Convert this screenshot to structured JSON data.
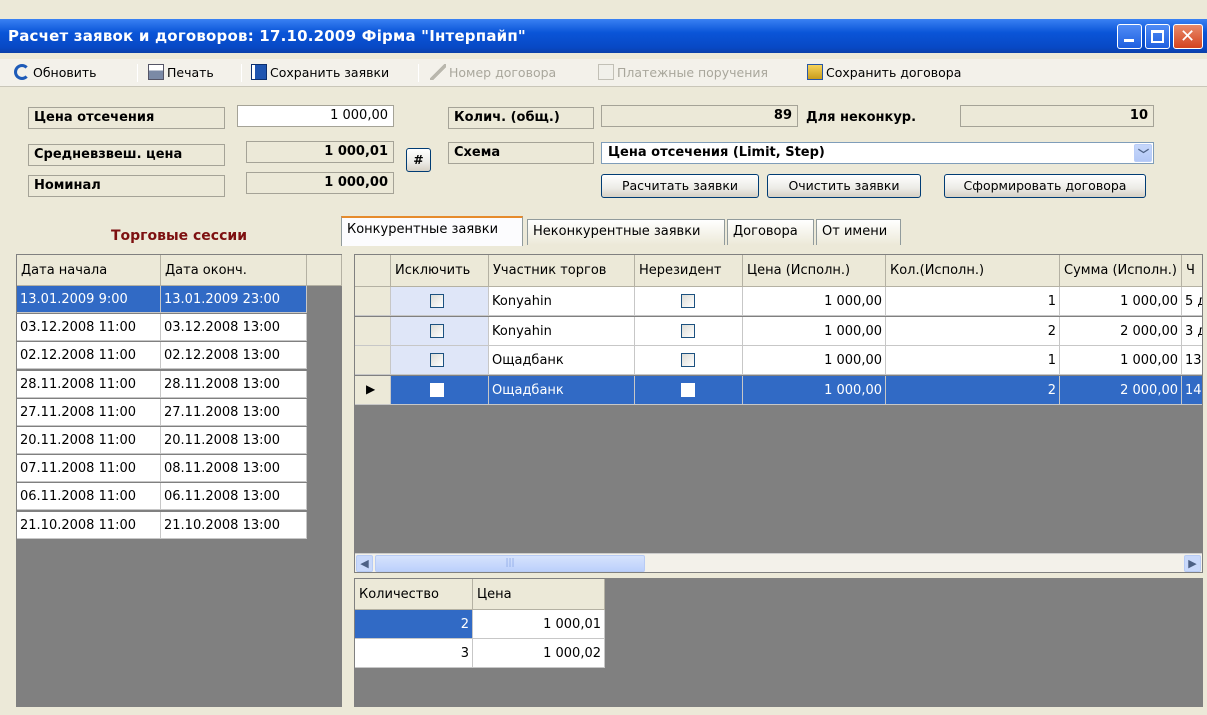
{
  "window": {
    "title": "Расчет заявок и договоров: 17.10.2009  Фірма \"Інтерпайп\""
  },
  "toolbar": {
    "refresh": "Обновить",
    "print": "Печать",
    "save_orders": "Сохранить заявки",
    "contract_number": "Номер договора",
    "payment_orders": "Платежные поручения",
    "save_contracts": "Сохранить договора"
  },
  "params": {
    "cutoff_price_label": "Цена отсечения",
    "cutoff_price_value": "1 000,00",
    "weighted_price_label": "Средневзвеш. цена",
    "weighted_price_value": "1 000,01",
    "nominal_label": "Номинал",
    "nominal_value": "1 000,00",
    "hash_button": "#",
    "qty_total_label": "Колич. (общ.)",
    "qty_total_value": "89",
    "noncompetitive_label": "Для неконкур.",
    "noncompetitive_value": "10",
    "scheme_label": "Схема",
    "scheme_value": "Цена отсечения (Limit, Step)",
    "calc_button": "Расчитать заявки",
    "clear_button": "Очистить заявки",
    "form_button": "Сформировать договора"
  },
  "sessions": {
    "title": "Торговые сессии",
    "columns": [
      "Дата начала",
      "Дата оконч."
    ],
    "rows": [
      [
        "13.01.2009 9:00",
        "13.01.2009 23:00"
      ],
      [
        "03.12.2008 11:00",
        "03.12.2008 13:00"
      ],
      [
        "02.12.2008 11:00",
        "02.12.2008 13:00"
      ],
      [
        "28.11.2008 11:00",
        "28.11.2008 13:00"
      ],
      [
        "27.11.2008 11:00",
        "27.11.2008 13:00"
      ],
      [
        "20.11.2008 11:00",
        "20.11.2008 13:00"
      ],
      [
        "07.11.2008 11:00",
        "08.11.2008 13:00"
      ],
      [
        "06.11.2008 11:00",
        "06.11.2008 13:00"
      ],
      [
        "21.10.2008 11:00",
        "21.10.2008 13:00"
      ]
    ]
  },
  "tabs": [
    "Конкурентные заявки",
    "Неконкурентные заявки",
    "Договора",
    "От имени"
  ],
  "orders": {
    "columns": [
      "Исключить",
      "Участник торгов",
      "Нерезидент",
      "Цена (Исполн.)",
      "Кол.(Исполн.)",
      "Сумма (Исполн.)",
      "Ч"
    ],
    "rows": [
      {
        "participant": "Konyahin",
        "price": "1 000,00",
        "qty": "1",
        "sum": "1 000,00",
        "extra": "5 д"
      },
      {
        "participant": "Konyahin",
        "price": "1 000,00",
        "qty": "2",
        "sum": "2 000,00",
        "extra": "3 д"
      },
      {
        "participant": "Ощадбанк",
        "price": "1 000,00",
        "qty": "1",
        "sum": "1 000,00",
        "extra": "13"
      },
      {
        "participant": "Ощадбанк",
        "price": "1 000,00",
        "qty": "2",
        "sum": "2 000,00",
        "extra": "14"
      }
    ]
  },
  "summary": {
    "columns": [
      "Количество",
      "Цена"
    ],
    "rows": [
      [
        "2",
        "1 000,01"
      ],
      [
        "3",
        "1 000,02"
      ]
    ]
  }
}
